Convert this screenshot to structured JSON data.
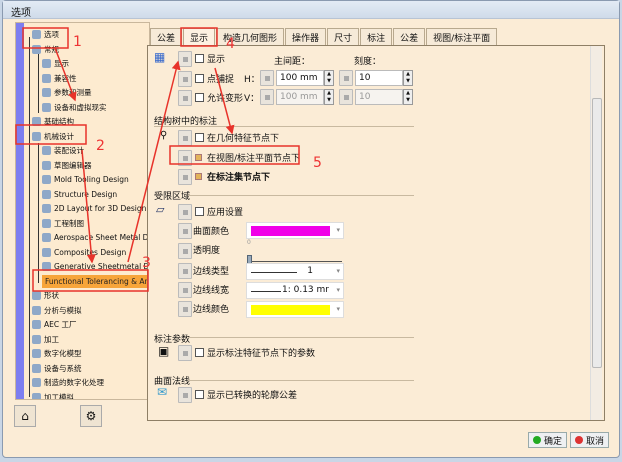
{
  "window": {
    "title": "选项"
  },
  "tree": {
    "items": [
      {
        "label": "选项",
        "level": 0
      },
      {
        "label": "常规",
        "level": 1
      },
      {
        "label": "显示",
        "level": 2
      },
      {
        "label": "兼容性",
        "level": 2
      },
      {
        "label": "参数和测量",
        "level": 2
      },
      {
        "label": "设备和虚拟现实",
        "level": 2
      },
      {
        "label": "基础结构",
        "level": 1
      },
      {
        "label": "机械设计",
        "level": 1
      },
      {
        "label": "装配设计",
        "level": 2
      },
      {
        "label": "草图编辑器",
        "level": 2
      },
      {
        "label": "Mold Tooling Design",
        "level": 2
      },
      {
        "label": "Structure Design",
        "level": 2
      },
      {
        "label": "2D Layout for 3D Design",
        "level": 2
      },
      {
        "label": "工程制图",
        "level": 2
      },
      {
        "label": "Aerospace Sheet Metal Design",
        "level": 2
      },
      {
        "label": "Composites Design",
        "level": 2
      },
      {
        "label": "Generative Sheetmetal Design",
        "level": 2
      },
      {
        "label": "Functional Tolerancing & Annotation",
        "level": 2,
        "selected": true
      },
      {
        "label": "形状",
        "level": 1
      },
      {
        "label": "分析与模拟",
        "level": 1
      },
      {
        "label": "AEC 工厂",
        "level": 1
      },
      {
        "label": "加工",
        "level": 1
      },
      {
        "label": "数字化模型",
        "level": 1
      },
      {
        "label": "设备与系统",
        "level": 1
      },
      {
        "label": "制造的数字化处理",
        "level": 1
      },
      {
        "label": "加工模拟",
        "level": 1
      }
    ]
  },
  "tabs": [
    "公差",
    "显示",
    "构造几何图形",
    "操作器",
    "尺寸",
    "标注",
    "公差",
    "视图/标注平面"
  ],
  "active_tab": 1,
  "grid": {
    "show": "显示",
    "snap": "点捕捉",
    "distort": "允许变形",
    "main_spacing": "主间距：",
    "graduation": "刻度：",
    "h_label": "H：",
    "v_label": "V：",
    "h_spacing": "100 mm",
    "h_grad": "10",
    "v_spacing": "100 mm",
    "v_grad": "10"
  },
  "spec_tree": {
    "title": "结构树中的标注",
    "opt1": "在几何特征节点下",
    "opt2": "在视图/标注平面节点下",
    "opt3": "在标注集节点下"
  },
  "limited_area": {
    "title": "受限区域",
    "apply": "应用设置",
    "surface_color": "曲面颜色",
    "transparency": "透明度",
    "transparency_value": "0",
    "edge_type": "边线类型",
    "edge_type_value": "1",
    "edge_width": "边线线宽",
    "edge_width_value": "1: 0.13 mr",
    "edge_color": "边线颜色",
    "surface_color_hex": "#f000e8",
    "edge_color_hex": "#ffff00"
  },
  "annotation_params": {
    "title": "标注参数",
    "opt": "显示标注特征节点下的参数"
  },
  "surface_normal": {
    "title": "曲面法线",
    "opt": "显示已转换的轮廓公差"
  },
  "buttons": {
    "ok": "确定",
    "cancel": "取消"
  },
  "annotations": {
    "n1": "1",
    "n2": "2",
    "n3": "3",
    "n4": "4",
    "n5": "5"
  },
  "colors": {
    "annotation": "#e8332a",
    "selection": "#f7a53a"
  }
}
